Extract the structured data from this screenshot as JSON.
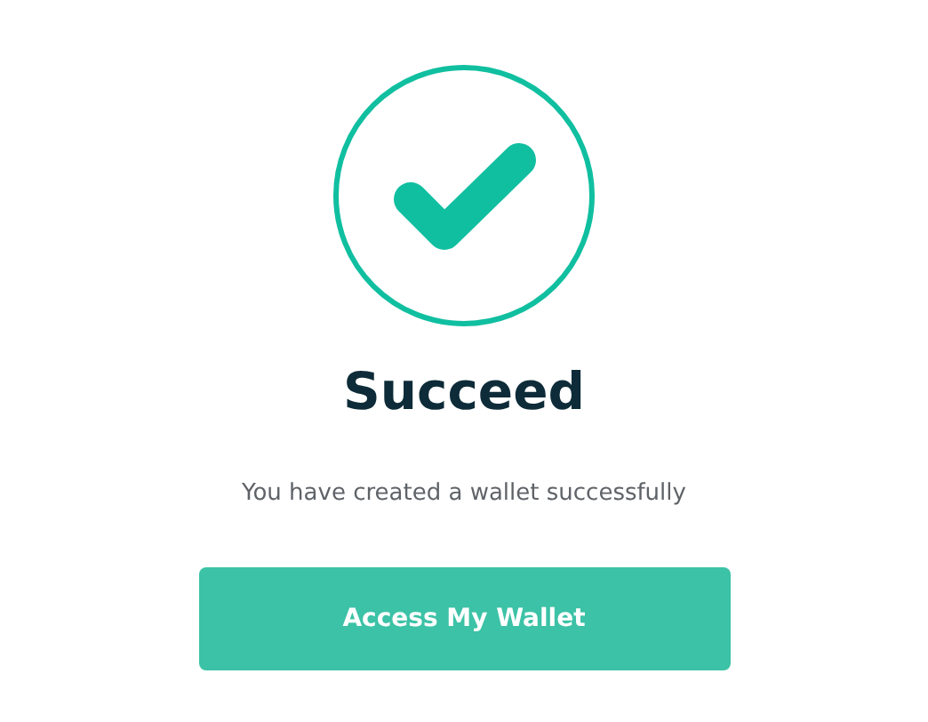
{
  "title": "Succeed",
  "message": "You have created a wallet successfully",
  "button": {
    "label": "Access My Wallet"
  }
}
